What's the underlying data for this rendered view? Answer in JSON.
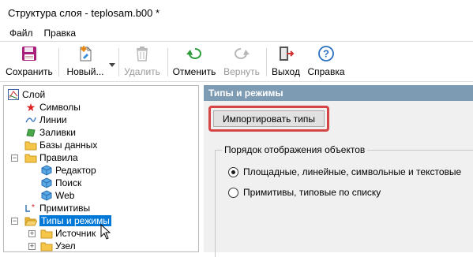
{
  "window": {
    "title": "Структура слоя - teplosam.b00 *"
  },
  "menu": {
    "items": [
      "Файл",
      "Правка"
    ]
  },
  "toolbar": {
    "save": "Сохранить",
    "new": "Новый...",
    "delete": "Удалить",
    "undo": "Отменить",
    "redo": "Вернуть",
    "exit": "Выход",
    "help": "Справка"
  },
  "tree": {
    "root": "Слой",
    "symbols": "Символы",
    "lines": "Линии",
    "fills": "Заливки",
    "databases": "Базы данных",
    "rules": "Правила",
    "editor": "Редактор",
    "search": "Поиск",
    "web": "Web",
    "primitives": "Примитивы",
    "types_modes": "Типы и режимы",
    "source": "Источник",
    "node": "Узел"
  },
  "panel": {
    "header": "Типы и режимы",
    "import_button": "Импортировать типы",
    "group_title": "Порядок отображения объектов",
    "radio1": "Площадные, линейные, символьные и текстовые",
    "radio2": "Примитивы, типовые по списку",
    "selected_radio": 1
  },
  "colors": {
    "highlight_frame": "#d64545",
    "selection": "#0078d7",
    "panel_header": "#7e9bb4"
  }
}
